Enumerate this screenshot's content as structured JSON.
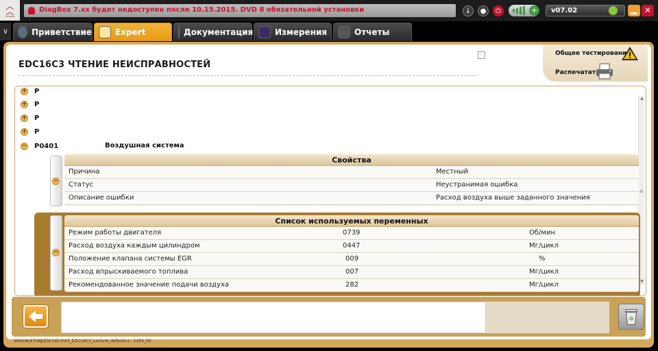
{
  "topbar": {
    "logo_text": "CITROËN",
    "ticker_text": "DiagBox 7.xx будет недоступен после 10.15.2015. DVD 8 обязательной установки",
    "version": "v07.02",
    "close_glyph": "✕"
  },
  "tabs": [
    {
      "label": "Приветствие",
      "icon": "greeting-icon",
      "active": false
    },
    {
      "label": "Expert",
      "icon": "expert-search-icon",
      "active": true
    },
    {
      "label": "Документация",
      "icon": "documentation-icon",
      "active": false
    },
    {
      "label": "Измерения",
      "icon": "measurement-wave-icon",
      "active": false
    },
    {
      "label": "Отчеты",
      "icon": "reports-icon",
      "active": false
    }
  ],
  "page": {
    "title": "EDC16C3  ЧТЕНИЕ НЕИСПРАВНОСТЕЙ",
    "small_btn": "-"
  },
  "actions": {
    "global_test": "Общее тестирование",
    "print": "Распечатать"
  },
  "codes": [
    {
      "code": "P",
      "desc": "",
      "expanded": false
    },
    {
      "code": "P",
      "desc": "",
      "expanded": false
    },
    {
      "code": "P",
      "desc": "",
      "expanded": false
    },
    {
      "code": "P",
      "desc": "",
      "expanded": false
    },
    {
      "code": "P0401",
      "desc": "Воздушная система",
      "expanded": true
    }
  ],
  "properties": {
    "header": "Свойства",
    "rows": [
      {
        "label": "Причина",
        "value": "Местный"
      },
      {
        "label": "Статус",
        "value": "Неустранимая ошибка"
      },
      {
        "label": "Описание ошибки",
        "value": "Расход воздуха выше заданного значения"
      }
    ]
  },
  "variables": {
    "header": "Список используемых переменных",
    "rows": [
      {
        "label": "Режим работы двигателя",
        "value": "0739",
        "unit": "Об/мин"
      },
      {
        "label": "Расход воздуха каждым цилиндром",
        "value": "0447",
        "unit": "Мг/цикл"
      },
      {
        "label": "Положение клапана системы EGR",
        "value": "009",
        "unit": "%"
      },
      {
        "label": "Расход впрыскиваемого топлива",
        "value": "007",
        "unit": "Мг/цикл"
      },
      {
        "label": "Рекомендованное значение подачи воздуха",
        "value": "282",
        "unit": "Мг/цикл"
      }
    ]
  },
  "footer": {
    "path": "Vehicle\\X7\\INJ\\EDC16C3\\X7_EDC16C3_Lecture_defauts.s : 1254_02"
  },
  "colors": {
    "accent": "#e89b12",
    "panel_border": "#d5a75d",
    "section_bg": "#a97b2f",
    "ticker_text": "#c8102e"
  }
}
